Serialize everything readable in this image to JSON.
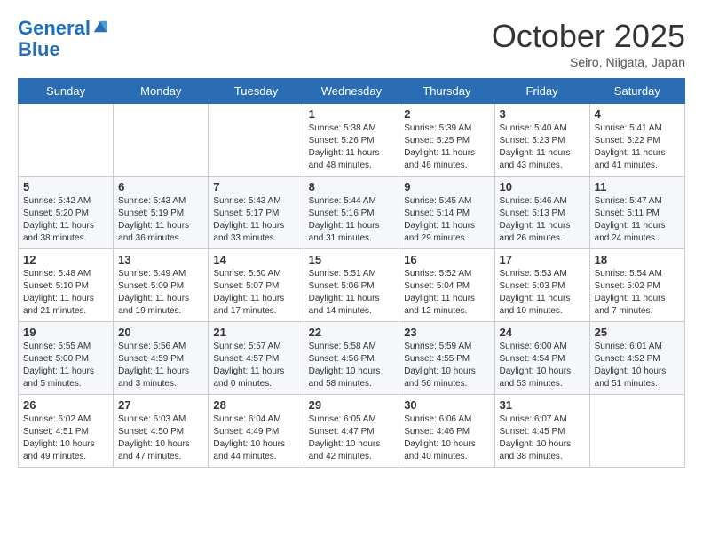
{
  "header": {
    "logo_line1": "General",
    "logo_line2": "Blue",
    "month": "October 2025",
    "location": "Seiro, Niigata, Japan"
  },
  "weekdays": [
    "Sunday",
    "Monday",
    "Tuesday",
    "Wednesday",
    "Thursday",
    "Friday",
    "Saturday"
  ],
  "weeks": [
    [
      {
        "day": "",
        "info": ""
      },
      {
        "day": "",
        "info": ""
      },
      {
        "day": "",
        "info": ""
      },
      {
        "day": "1",
        "info": "Sunrise: 5:38 AM\nSunset: 5:26 PM\nDaylight: 11 hours\nand 48 minutes."
      },
      {
        "day": "2",
        "info": "Sunrise: 5:39 AM\nSunset: 5:25 PM\nDaylight: 11 hours\nand 46 minutes."
      },
      {
        "day": "3",
        "info": "Sunrise: 5:40 AM\nSunset: 5:23 PM\nDaylight: 11 hours\nand 43 minutes."
      },
      {
        "day": "4",
        "info": "Sunrise: 5:41 AM\nSunset: 5:22 PM\nDaylight: 11 hours\nand 41 minutes."
      }
    ],
    [
      {
        "day": "5",
        "info": "Sunrise: 5:42 AM\nSunset: 5:20 PM\nDaylight: 11 hours\nand 38 minutes."
      },
      {
        "day": "6",
        "info": "Sunrise: 5:43 AM\nSunset: 5:19 PM\nDaylight: 11 hours\nand 36 minutes."
      },
      {
        "day": "7",
        "info": "Sunrise: 5:43 AM\nSunset: 5:17 PM\nDaylight: 11 hours\nand 33 minutes."
      },
      {
        "day": "8",
        "info": "Sunrise: 5:44 AM\nSunset: 5:16 PM\nDaylight: 11 hours\nand 31 minutes."
      },
      {
        "day": "9",
        "info": "Sunrise: 5:45 AM\nSunset: 5:14 PM\nDaylight: 11 hours\nand 29 minutes."
      },
      {
        "day": "10",
        "info": "Sunrise: 5:46 AM\nSunset: 5:13 PM\nDaylight: 11 hours\nand 26 minutes."
      },
      {
        "day": "11",
        "info": "Sunrise: 5:47 AM\nSunset: 5:11 PM\nDaylight: 11 hours\nand 24 minutes."
      }
    ],
    [
      {
        "day": "12",
        "info": "Sunrise: 5:48 AM\nSunset: 5:10 PM\nDaylight: 11 hours\nand 21 minutes."
      },
      {
        "day": "13",
        "info": "Sunrise: 5:49 AM\nSunset: 5:09 PM\nDaylight: 11 hours\nand 19 minutes."
      },
      {
        "day": "14",
        "info": "Sunrise: 5:50 AM\nSunset: 5:07 PM\nDaylight: 11 hours\nand 17 minutes."
      },
      {
        "day": "15",
        "info": "Sunrise: 5:51 AM\nSunset: 5:06 PM\nDaylight: 11 hours\nand 14 minutes."
      },
      {
        "day": "16",
        "info": "Sunrise: 5:52 AM\nSunset: 5:04 PM\nDaylight: 11 hours\nand 12 minutes."
      },
      {
        "day": "17",
        "info": "Sunrise: 5:53 AM\nSunset: 5:03 PM\nDaylight: 11 hours\nand 10 minutes."
      },
      {
        "day": "18",
        "info": "Sunrise: 5:54 AM\nSunset: 5:02 PM\nDaylight: 11 hours\nand 7 minutes."
      }
    ],
    [
      {
        "day": "19",
        "info": "Sunrise: 5:55 AM\nSunset: 5:00 PM\nDaylight: 11 hours\nand 5 minutes."
      },
      {
        "day": "20",
        "info": "Sunrise: 5:56 AM\nSunset: 4:59 PM\nDaylight: 11 hours\nand 3 minutes."
      },
      {
        "day": "21",
        "info": "Sunrise: 5:57 AM\nSunset: 4:57 PM\nDaylight: 11 hours\nand 0 minutes."
      },
      {
        "day": "22",
        "info": "Sunrise: 5:58 AM\nSunset: 4:56 PM\nDaylight: 10 hours\nand 58 minutes."
      },
      {
        "day": "23",
        "info": "Sunrise: 5:59 AM\nSunset: 4:55 PM\nDaylight: 10 hours\nand 56 minutes."
      },
      {
        "day": "24",
        "info": "Sunrise: 6:00 AM\nSunset: 4:54 PM\nDaylight: 10 hours\nand 53 minutes."
      },
      {
        "day": "25",
        "info": "Sunrise: 6:01 AM\nSunset: 4:52 PM\nDaylight: 10 hours\nand 51 minutes."
      }
    ],
    [
      {
        "day": "26",
        "info": "Sunrise: 6:02 AM\nSunset: 4:51 PM\nDaylight: 10 hours\nand 49 minutes."
      },
      {
        "day": "27",
        "info": "Sunrise: 6:03 AM\nSunset: 4:50 PM\nDaylight: 10 hours\nand 47 minutes."
      },
      {
        "day": "28",
        "info": "Sunrise: 6:04 AM\nSunset: 4:49 PM\nDaylight: 10 hours\nand 44 minutes."
      },
      {
        "day": "29",
        "info": "Sunrise: 6:05 AM\nSunset: 4:47 PM\nDaylight: 10 hours\nand 42 minutes."
      },
      {
        "day": "30",
        "info": "Sunrise: 6:06 AM\nSunset: 4:46 PM\nDaylight: 10 hours\nand 40 minutes."
      },
      {
        "day": "31",
        "info": "Sunrise: 6:07 AM\nSunset: 4:45 PM\nDaylight: 10 hours\nand 38 minutes."
      },
      {
        "day": "",
        "info": ""
      }
    ]
  ]
}
